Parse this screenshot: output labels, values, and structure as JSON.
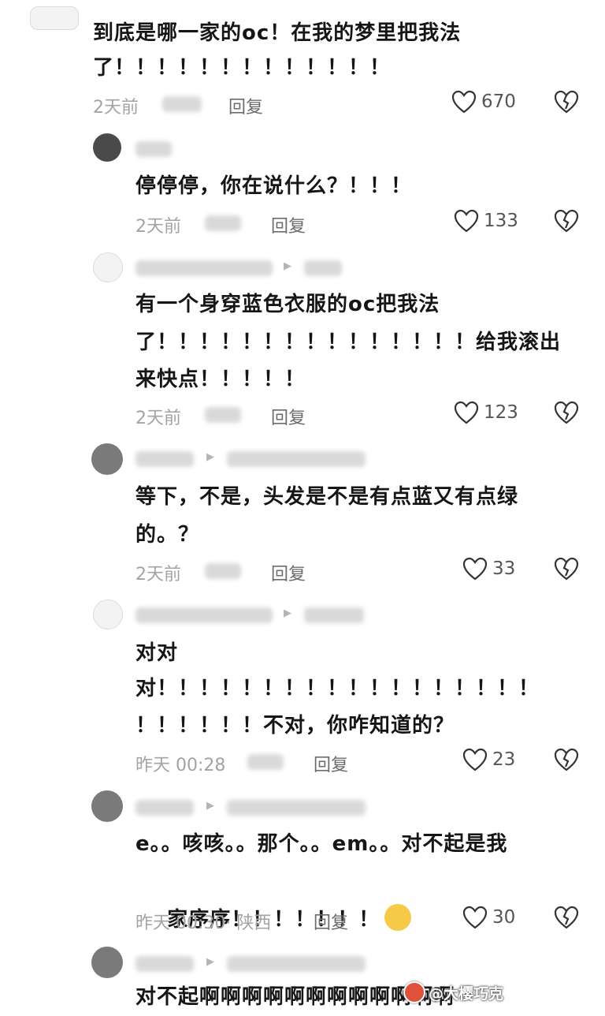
{
  "comments": [
    {
      "lines": [
        "到底是哪一家的oc！在我的梦里把我法",
        "了！！！！！！！！！！！！！"
      ],
      "time": "2天前",
      "reply_label": "回复",
      "likes": "670"
    },
    {
      "lines": [
        "停停停，你在说什么？！！！"
      ],
      "time": "2天前",
      "reply_label": "回复",
      "likes": "133"
    },
    {
      "lines": [
        "有一个身穿蓝色衣服的oc把我法",
        "了！！！！！！！！！！！！！！！给我滚出",
        "来快点！！！！！"
      ],
      "time": "2天前",
      "reply_label": "回复",
      "likes": "123"
    },
    {
      "lines": [
        "等下，不是，头发是不是有点蓝又有点绿",
        "的。？"
      ],
      "time": "2天前",
      "reply_label": "回复",
      "likes": "33"
    },
    {
      "lines": [
        "对对",
        "对！！！！！！！！！！！！！！！！！！",
        "！！！！！！不对，你咋知道的？"
      ],
      "time": "昨天 00:28",
      "reply_label": "回复",
      "likes": "23"
    },
    {
      "lines": [
        "e。。咳咳。。那个。。em。。对不起是我",
        "家序序！！！！！！！"
      ],
      "time": "昨天 00:30",
      "ip": "· 陕西",
      "reply_label": "回复",
      "likes": "30"
    },
    {
      "lines": [
        "对不起啊啊啊啊啊啊啊啊啊啊啊啊"
      ]
    }
  ],
  "watermark": "@大樱巧克"
}
